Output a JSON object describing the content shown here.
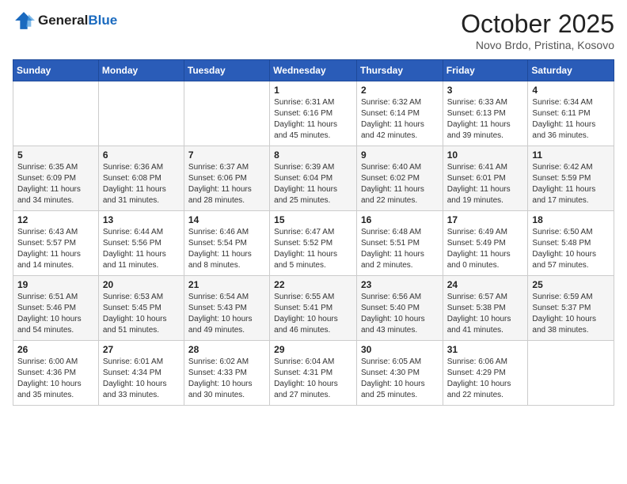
{
  "header": {
    "logo_line1": "General",
    "logo_line2": "Blue",
    "month": "October 2025",
    "location": "Novo Brdo, Pristina, Kosovo"
  },
  "days_of_week": [
    "Sunday",
    "Monday",
    "Tuesday",
    "Wednesday",
    "Thursday",
    "Friday",
    "Saturday"
  ],
  "weeks": [
    [
      {
        "day": "",
        "sunrise": "",
        "sunset": "",
        "daylight": ""
      },
      {
        "day": "",
        "sunrise": "",
        "sunset": "",
        "daylight": ""
      },
      {
        "day": "",
        "sunrise": "",
        "sunset": "",
        "daylight": ""
      },
      {
        "day": "1",
        "sunrise": "Sunrise: 6:31 AM",
        "sunset": "Sunset: 6:16 PM",
        "daylight": "Daylight: 11 hours and 45 minutes."
      },
      {
        "day": "2",
        "sunrise": "Sunrise: 6:32 AM",
        "sunset": "Sunset: 6:14 PM",
        "daylight": "Daylight: 11 hours and 42 minutes."
      },
      {
        "day": "3",
        "sunrise": "Sunrise: 6:33 AM",
        "sunset": "Sunset: 6:13 PM",
        "daylight": "Daylight: 11 hours and 39 minutes."
      },
      {
        "day": "4",
        "sunrise": "Sunrise: 6:34 AM",
        "sunset": "Sunset: 6:11 PM",
        "daylight": "Daylight: 11 hours and 36 minutes."
      }
    ],
    [
      {
        "day": "5",
        "sunrise": "Sunrise: 6:35 AM",
        "sunset": "Sunset: 6:09 PM",
        "daylight": "Daylight: 11 hours and 34 minutes."
      },
      {
        "day": "6",
        "sunrise": "Sunrise: 6:36 AM",
        "sunset": "Sunset: 6:08 PM",
        "daylight": "Daylight: 11 hours and 31 minutes."
      },
      {
        "day": "7",
        "sunrise": "Sunrise: 6:37 AM",
        "sunset": "Sunset: 6:06 PM",
        "daylight": "Daylight: 11 hours and 28 minutes."
      },
      {
        "day": "8",
        "sunrise": "Sunrise: 6:39 AM",
        "sunset": "Sunset: 6:04 PM",
        "daylight": "Daylight: 11 hours and 25 minutes."
      },
      {
        "day": "9",
        "sunrise": "Sunrise: 6:40 AM",
        "sunset": "Sunset: 6:02 PM",
        "daylight": "Daylight: 11 hours and 22 minutes."
      },
      {
        "day": "10",
        "sunrise": "Sunrise: 6:41 AM",
        "sunset": "Sunset: 6:01 PM",
        "daylight": "Daylight: 11 hours and 19 minutes."
      },
      {
        "day": "11",
        "sunrise": "Sunrise: 6:42 AM",
        "sunset": "Sunset: 5:59 PM",
        "daylight": "Daylight: 11 hours and 17 minutes."
      }
    ],
    [
      {
        "day": "12",
        "sunrise": "Sunrise: 6:43 AM",
        "sunset": "Sunset: 5:57 PM",
        "daylight": "Daylight: 11 hours and 14 minutes."
      },
      {
        "day": "13",
        "sunrise": "Sunrise: 6:44 AM",
        "sunset": "Sunset: 5:56 PM",
        "daylight": "Daylight: 11 hours and 11 minutes."
      },
      {
        "day": "14",
        "sunrise": "Sunrise: 6:46 AM",
        "sunset": "Sunset: 5:54 PM",
        "daylight": "Daylight: 11 hours and 8 minutes."
      },
      {
        "day": "15",
        "sunrise": "Sunrise: 6:47 AM",
        "sunset": "Sunset: 5:52 PM",
        "daylight": "Daylight: 11 hours and 5 minutes."
      },
      {
        "day": "16",
        "sunrise": "Sunrise: 6:48 AM",
        "sunset": "Sunset: 5:51 PM",
        "daylight": "Daylight: 11 hours and 2 minutes."
      },
      {
        "day": "17",
        "sunrise": "Sunrise: 6:49 AM",
        "sunset": "Sunset: 5:49 PM",
        "daylight": "Daylight: 11 hours and 0 minutes."
      },
      {
        "day": "18",
        "sunrise": "Sunrise: 6:50 AM",
        "sunset": "Sunset: 5:48 PM",
        "daylight": "Daylight: 10 hours and 57 minutes."
      }
    ],
    [
      {
        "day": "19",
        "sunrise": "Sunrise: 6:51 AM",
        "sunset": "Sunset: 5:46 PM",
        "daylight": "Daylight: 10 hours and 54 minutes."
      },
      {
        "day": "20",
        "sunrise": "Sunrise: 6:53 AM",
        "sunset": "Sunset: 5:45 PM",
        "daylight": "Daylight: 10 hours and 51 minutes."
      },
      {
        "day": "21",
        "sunrise": "Sunrise: 6:54 AM",
        "sunset": "Sunset: 5:43 PM",
        "daylight": "Daylight: 10 hours and 49 minutes."
      },
      {
        "day": "22",
        "sunrise": "Sunrise: 6:55 AM",
        "sunset": "Sunset: 5:41 PM",
        "daylight": "Daylight: 10 hours and 46 minutes."
      },
      {
        "day": "23",
        "sunrise": "Sunrise: 6:56 AM",
        "sunset": "Sunset: 5:40 PM",
        "daylight": "Daylight: 10 hours and 43 minutes."
      },
      {
        "day": "24",
        "sunrise": "Sunrise: 6:57 AM",
        "sunset": "Sunset: 5:38 PM",
        "daylight": "Daylight: 10 hours and 41 minutes."
      },
      {
        "day": "25",
        "sunrise": "Sunrise: 6:59 AM",
        "sunset": "Sunset: 5:37 PM",
        "daylight": "Daylight: 10 hours and 38 minutes."
      }
    ],
    [
      {
        "day": "26",
        "sunrise": "Sunrise: 6:00 AM",
        "sunset": "Sunset: 4:36 PM",
        "daylight": "Daylight: 10 hours and 35 minutes."
      },
      {
        "day": "27",
        "sunrise": "Sunrise: 6:01 AM",
        "sunset": "Sunset: 4:34 PM",
        "daylight": "Daylight: 10 hours and 33 minutes."
      },
      {
        "day": "28",
        "sunrise": "Sunrise: 6:02 AM",
        "sunset": "Sunset: 4:33 PM",
        "daylight": "Daylight: 10 hours and 30 minutes."
      },
      {
        "day": "29",
        "sunrise": "Sunrise: 6:04 AM",
        "sunset": "Sunset: 4:31 PM",
        "daylight": "Daylight: 10 hours and 27 minutes."
      },
      {
        "day": "30",
        "sunrise": "Sunrise: 6:05 AM",
        "sunset": "Sunset: 4:30 PM",
        "daylight": "Daylight: 10 hours and 25 minutes."
      },
      {
        "day": "31",
        "sunrise": "Sunrise: 6:06 AM",
        "sunset": "Sunset: 4:29 PM",
        "daylight": "Daylight: 10 hours and 22 minutes."
      },
      {
        "day": "",
        "sunrise": "",
        "sunset": "",
        "daylight": ""
      }
    ]
  ]
}
